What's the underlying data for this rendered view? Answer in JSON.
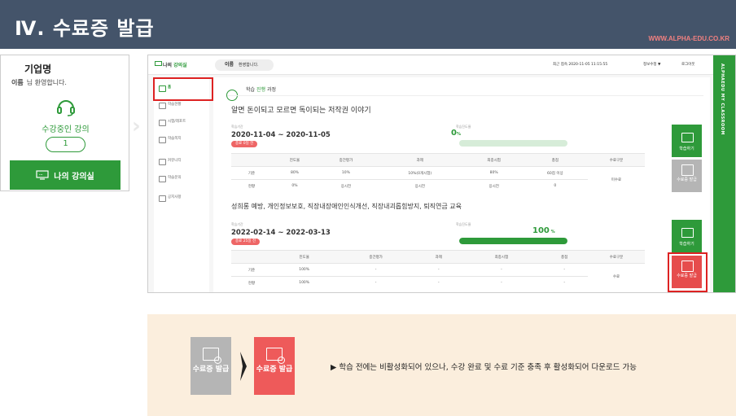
{
  "header": {
    "title": "Ⅳ. 수료증 발급",
    "url": "WWW.ALPHA-EDU.CO.KR"
  },
  "card": {
    "company": "기업명",
    "name_label": "이름",
    "welcome": "님 환영합니다.",
    "status_label": "수강중인 강의",
    "count": "1",
    "button": "나의 강의실"
  },
  "screen": {
    "topbar": {
      "brand_prefix": "나의",
      "brand_suffix": "강의실",
      "name_label": "이름",
      "welcome": "환영합니다.",
      "last_login": "최근 접속 2020-11-05 11:15:55",
      "edit_info": "정보수정 ▼",
      "logout": "로그아웃"
    },
    "side_title": "ALPHAEDU  MY CLASSROOM",
    "nav": [
      "홈",
      "학습현황",
      "시험/레포트",
      "학습쪽지",
      "커뮤니티",
      "학습문의",
      "공지사항"
    ],
    "crumb_prefix": "학습",
    "crumb_highlight": "진행",
    "crumb_suffix": "과정",
    "period_label": "학습기간",
    "progress_label": "학습진도율",
    "columns": [
      "진도율",
      "중간평가",
      "과제",
      "최종시험",
      "총점",
      "수료구분"
    ],
    "courses": [
      {
        "title": "알면 돈이되고 모르면 독이되는 저작권 이야기",
        "dates": "2020-11-04 ~ 2020-11-05",
        "badge": "종료 0일 전",
        "progress": "0",
        "progress_value": 0,
        "rows": [
          {
            "label": "기준",
            "cells": [
              "80%",
              "10%",
              "10%(0개시험)",
              "80%",
              "60점 이상"
            ]
          },
          {
            "label": "현황",
            "cells": [
              "0%",
              "응시전",
              "응시전",
              "응시전",
              "0"
            ]
          }
        ],
        "status": "미수료",
        "study_button": "학습하기",
        "cert_button": "수료증 발급",
        "cert_active": false
      },
      {
        "title": "성희롱 예방, 개인정보보호, 직장내장애인인식개선, 직장내괴롭힘방지, 퇴직연금 교육",
        "dates": "2022-02-14 ~ 2022-03-13",
        "badge": "종료 25일 전",
        "progress": "100",
        "progress_value": 100,
        "rows": [
          {
            "label": "기준",
            "cells": [
              "100%",
              "-",
              "-",
              "-",
              "-"
            ]
          },
          {
            "label": "현황",
            "cells": [
              "100%",
              "-",
              "-",
              "-",
              "-"
            ]
          }
        ],
        "status": "수료",
        "study_button": "학습하기",
        "cert_button": "수료증 발급",
        "cert_active": true
      }
    ]
  },
  "panel": {
    "cert_inactive": "수료증 발급",
    "cert_active": "수료증 발급",
    "note": "▶ 학습 전에는 비활성화되어 있으나, 수강 완료 및 수료 기준 충족 후 활성화되어 다운로드 가능"
  },
  "colors": {
    "green": "#2e9a3a",
    "red": "#d22",
    "header": "#44546a",
    "inactive": "#b5b5b5",
    "active": "#ee5a5a"
  }
}
